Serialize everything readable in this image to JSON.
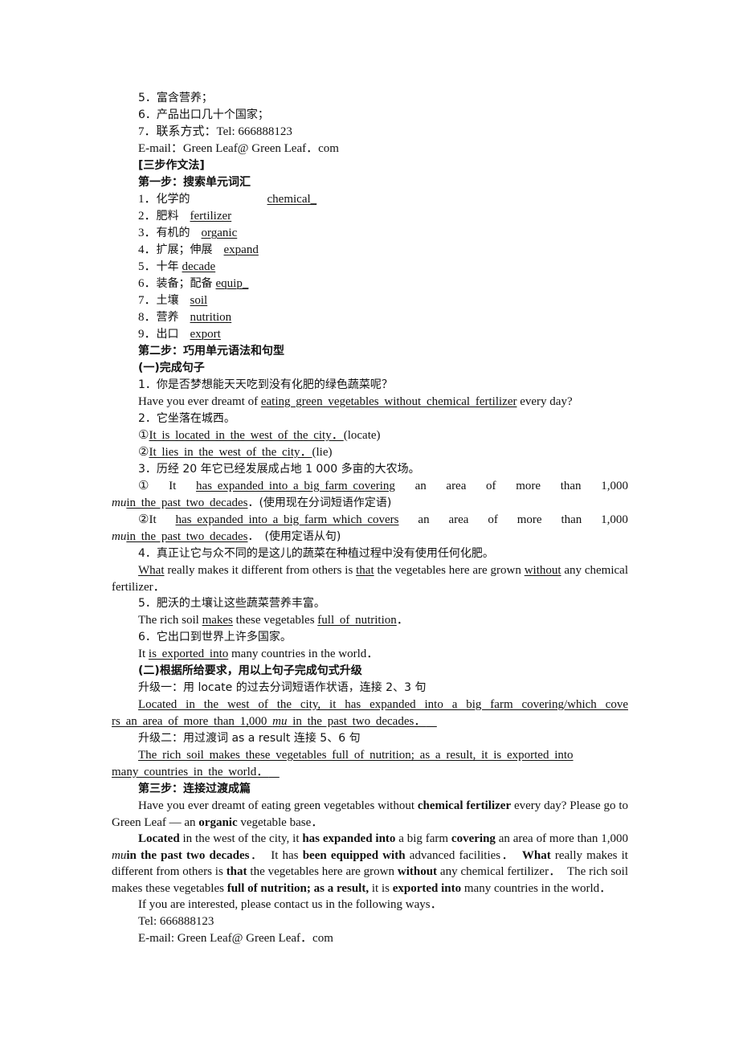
{
  "intro_list": [
    "5．富含营养；",
    "6．产品出口几十个国家；",
    "7．联系方式：Tel: 666888123",
    "E-mail：Green Leaf@ Green Leaf．com"
  ],
  "method_title": "[三步作文法]",
  "step1": {
    "title": "第一步：搜索单元词汇",
    "vocab": [
      {
        "num": "1．",
        "cn": "化学的",
        "en": "chemical_"
      },
      {
        "num": "2．",
        "cn": "肥料",
        "en": "fertilizer"
      },
      {
        "num": "3．",
        "cn": "有机的",
        "en": "organic"
      },
      {
        "num": "4．",
        "cn": "扩展；伸展",
        "en": "expand"
      },
      {
        "num": "5．",
        "cn": "十年",
        "en": "decade"
      },
      {
        "num": "6．",
        "cn": "装备；配备",
        "en": "equip_"
      },
      {
        "num": "7．",
        "cn": "土壤",
        "en": "soil"
      },
      {
        "num": "8．",
        "cn": "营养",
        "en": "nutrition"
      },
      {
        "num": "9．",
        "cn": "出口",
        "en": "export"
      }
    ]
  },
  "step2": {
    "title": "第二步：巧用单元语法和句型",
    "part1_title": "(一)完成句子",
    "s1_cn": "1．你是否梦想能天天吃到没有化肥的绿色蔬菜呢？",
    "s1_pre": "Have you ever dreamt of ",
    "s1_ans": "eating green vegetables without chemical fertilizer",
    "s1_post": " every day?",
    "s2_cn": "2．它坐落在城西。",
    "s2a_mark": "①",
    "s2a_ans": "It is located in the west of the city．",
    "s2a_hint": "(locate)",
    "s2b_mark": "②",
    "s2b_ans": "It lies in the west of the city．",
    "s2b_hint": "(lie)",
    "s3_cn": "3．历经 20 年它已经发展成占地 1 000 多亩的大农场。",
    "s3a_mark": "①",
    "s3a_it": "It",
    "s3a_ans": "has expanded into a big farm covering",
    "s3a_words": [
      "an",
      "area",
      "of",
      "more",
      "than",
      "1,000"
    ],
    "s3a_mu": "mu",
    "s3a_ans2": "in the past two decades",
    "s3a_hint": "．(使用现在分词短语作定语)",
    "s3b_mark": "②It",
    "s3b_ans": "has expanded into a big farm which covers",
    "s3b_words": [
      "an",
      "area",
      "of",
      "more",
      "than",
      "1,000"
    ],
    "s3b_mu": "mu",
    "s3b_ans2": "in the past two decades",
    "s3b_hint": "．　(使用定语从句)",
    "s4_cn": "4．真正让它与众不同的是这儿的蔬菜在种植过程中没有使用任何化肥。",
    "s4_a1": "What",
    "s4_t1": " really makes it different from others is ",
    "s4_a2": "that",
    "s4_t2": " the vegetables here are grown ",
    "s4_a3": "without",
    "s4_t3": " any chemical fertilizer．",
    "s5_cn": "5．肥沃的土壤让这些蔬菜营养丰富。",
    "s5_t1": "The rich soil ",
    "s5_a1": "makes",
    "s5_t2": " these vegetables ",
    "s5_a2": "full of nutrition",
    "s5_t3": "．",
    "s6_cn": "6．它出口到世界上许多国家。",
    "s6_t1": "It ",
    "s6_a1": "is exported into",
    "s6_t2": " many countries in the world．",
    "part2_title": "(二)根据所给要求，用以上句子完成句式升级",
    "up1_title": "升级一：用 locate 的过去分词短语作状语，连接 2、3 句",
    "up1_ans_a": "Located in the west of the city, it has expanded into a big farm covering/which cove",
    "up1_ans_b1": "rs an area of more than 1,000 ",
    "up1_ans_mu": "mu",
    "up1_ans_b2": " in the past two decades．",
    "up2_title": "升级二：用过渡词 as a result 连接 5、6 句",
    "up2_ans_a": "The rich soil makes these vegetables full of nutrition; as a result, it is exported into",
    "up2_ans_b": "many countries in the world．"
  },
  "step3": {
    "title": "第三步：连接过渡成篇",
    "p1": [
      {
        "t": "Have you ever dreamt of eating green vegetables without "
      },
      {
        "t": "chemical fertilizer",
        "b": true
      },
      {
        "t": " every day? Please go to Green Leaf — an "
      },
      {
        "t": "organic",
        "b": true
      },
      {
        "t": " vegetable base．"
      }
    ],
    "p2": [
      {
        "t": "Located",
        "b": true
      },
      {
        "t": " in the west of the city, it "
      },
      {
        "t": "has expanded into",
        "b": true
      },
      {
        "t": " a big farm "
      },
      {
        "t": "covering",
        "b": true
      },
      {
        "t": " an area of more than 1,000 "
      },
      {
        "t": "mu",
        "i": true
      },
      {
        "t": "in the past two decades",
        "b": true
      },
      {
        "t": "．　It has "
      },
      {
        "t": "been equipped with",
        "b": true
      },
      {
        "t": " advanced facilities．　"
      },
      {
        "t": "What",
        "b": true
      },
      {
        "t": " really makes it different from others is "
      },
      {
        "t": "that",
        "b": true
      },
      {
        "t": " the vegetables here are grown "
      },
      {
        "t": "without",
        "b": true
      },
      {
        "t": " any chemical fertilizer．　The rich soil makes these vegetables "
      },
      {
        "t": "full of nutrition; as a result,",
        "b": true
      },
      {
        "t": " it is "
      },
      {
        "t": "exported into",
        "b": true
      },
      {
        "t": " many countries in the world．"
      }
    ],
    "closing": "If you are interested, please contact us in the following ways．",
    "tel": "Tel: 666888123",
    "email": "E-mail: Green Leaf@ Green Leaf．com"
  }
}
